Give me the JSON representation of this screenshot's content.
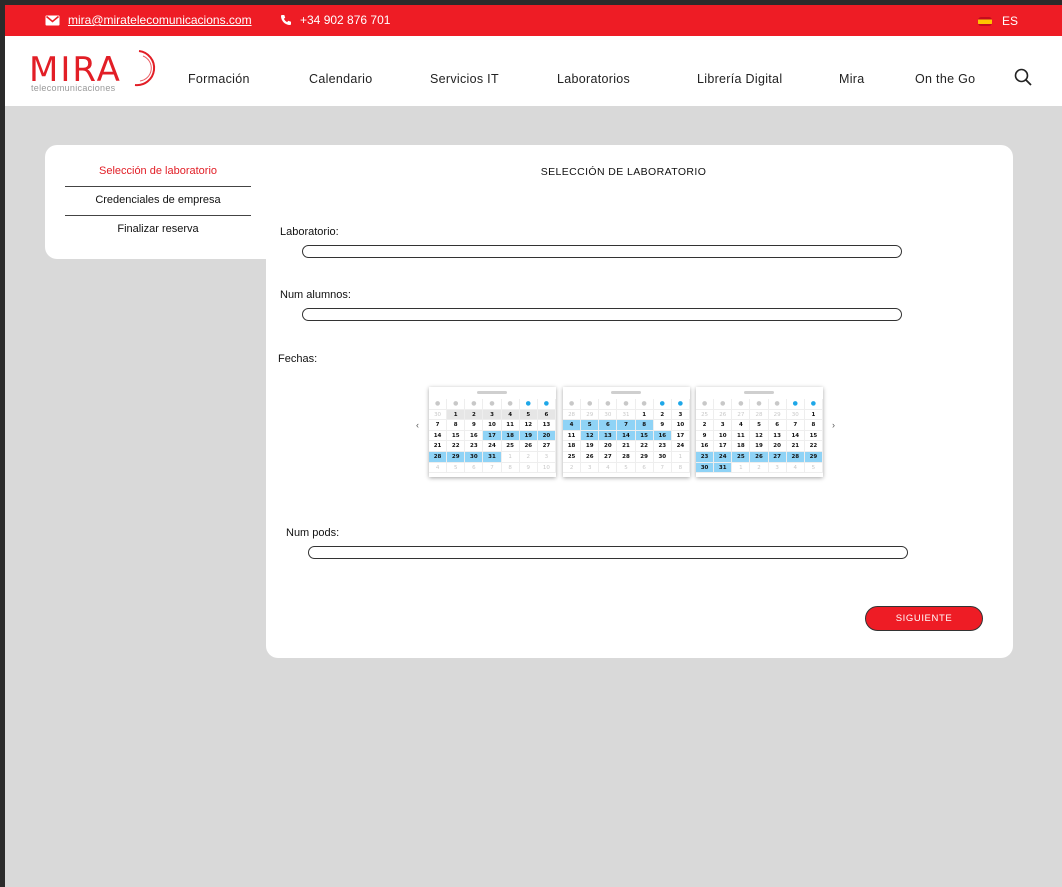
{
  "topbar": {
    "email": "mira@miratelecomunicacions.com",
    "phone": "+34 902 876 701",
    "lang": "ES",
    "icons": [
      "mail-icon",
      "phone-icon",
      "flag-icon"
    ]
  },
  "logo": {
    "word": "MIRA",
    "tagline": "telecomunicaciones"
  },
  "nav": [
    "Formación",
    "Calendario",
    "Servicios IT",
    "Laboratorios",
    "Librería Digital",
    "Mira",
    "On the Go"
  ],
  "sidebar": {
    "items": [
      "Selección de laboratorio",
      "Credenciales de empresa",
      "Finalizar reserva"
    ],
    "active_index": 0
  },
  "form": {
    "title": "SELECCIÓN DE LABORATORIO",
    "laboratorio_label": "Laboratorio:",
    "laboratorio_value": "",
    "alumnos_label": "Num alumnos:",
    "alumnos_value": "",
    "fechas_label": "Fechas:",
    "pods_label": "Num pods:",
    "pods_value": "",
    "next_label": "SIGUIENTE",
    "prev_glyph": "‹",
    "next_glyph": "›"
  },
  "colors": {
    "brand": "#ee1c25",
    "selected_day": "#8fd3f6",
    "weekend_dot": "#1ea7e8"
  },
  "calendars": [
    {
      "weeks": [
        [
          "30",
          "1",
          "2",
          "3",
          "4",
          "5",
          "6"
        ],
        [
          "7",
          "8",
          "9",
          "10",
          "11",
          "12",
          "13"
        ],
        [
          "14",
          "15",
          "16",
          "17",
          "18",
          "19",
          "20"
        ],
        [
          "21",
          "22",
          "23",
          "24",
          "25",
          "26",
          "27"
        ],
        [
          "28",
          "29",
          "30",
          "31",
          "1",
          "2",
          "3"
        ],
        [
          "4",
          "5",
          "6",
          "7",
          "8",
          "9",
          "10"
        ]
      ],
      "muted": [
        "0-0",
        "4-4",
        "4-5",
        "4-6",
        "5-0",
        "5-1",
        "5-2",
        "5-3",
        "5-4",
        "5-5",
        "5-6"
      ],
      "grey": [
        "0-1",
        "0-2",
        "0-3",
        "0-4",
        "0-5",
        "0-6"
      ],
      "selected": [
        "2-3",
        "2-4",
        "2-5",
        "2-6",
        "4-0",
        "4-1",
        "4-2",
        "4-3"
      ]
    },
    {
      "weeks": [
        [
          "28",
          "29",
          "30",
          "31",
          "1",
          "2",
          "3"
        ],
        [
          "4",
          "5",
          "6",
          "7",
          "8",
          "9",
          "10"
        ],
        [
          "11",
          "12",
          "13",
          "14",
          "15",
          "16",
          "17"
        ],
        [
          "18",
          "19",
          "20",
          "21",
          "22",
          "23",
          "24"
        ],
        [
          "25",
          "26",
          "27",
          "28",
          "29",
          "30",
          "1"
        ],
        [
          "2",
          "3",
          "4",
          "5",
          "6",
          "7",
          "8"
        ]
      ],
      "muted": [
        "0-0",
        "0-1",
        "0-2",
        "0-3",
        "4-6",
        "5-0",
        "5-1",
        "5-2",
        "5-3",
        "5-4",
        "5-5",
        "5-6"
      ],
      "grey": [],
      "selected": [
        "1-0",
        "1-1",
        "1-2",
        "1-3",
        "1-4",
        "2-1",
        "2-2",
        "2-3",
        "2-4",
        "2-5"
      ]
    },
    {
      "weeks": [
        [
          "25",
          "26",
          "27",
          "28",
          "29",
          "30",
          "1"
        ],
        [
          "2",
          "3",
          "4",
          "5",
          "6",
          "7",
          "8"
        ],
        [
          "9",
          "10",
          "11",
          "12",
          "13",
          "14",
          "15"
        ],
        [
          "16",
          "17",
          "18",
          "19",
          "20",
          "21",
          "22"
        ],
        [
          "23",
          "24",
          "25",
          "26",
          "27",
          "28",
          "29"
        ],
        [
          "30",
          "31",
          "1",
          "2",
          "3",
          "4",
          "5"
        ]
      ],
      "muted": [
        "0-0",
        "0-1",
        "0-2",
        "0-3",
        "0-4",
        "0-5",
        "5-2",
        "5-3",
        "5-4",
        "5-5",
        "5-6"
      ],
      "grey": [],
      "selected": [
        "4-0",
        "4-1",
        "4-2",
        "4-3",
        "4-4",
        "4-5",
        "4-6",
        "5-0",
        "5-1"
      ]
    }
  ]
}
